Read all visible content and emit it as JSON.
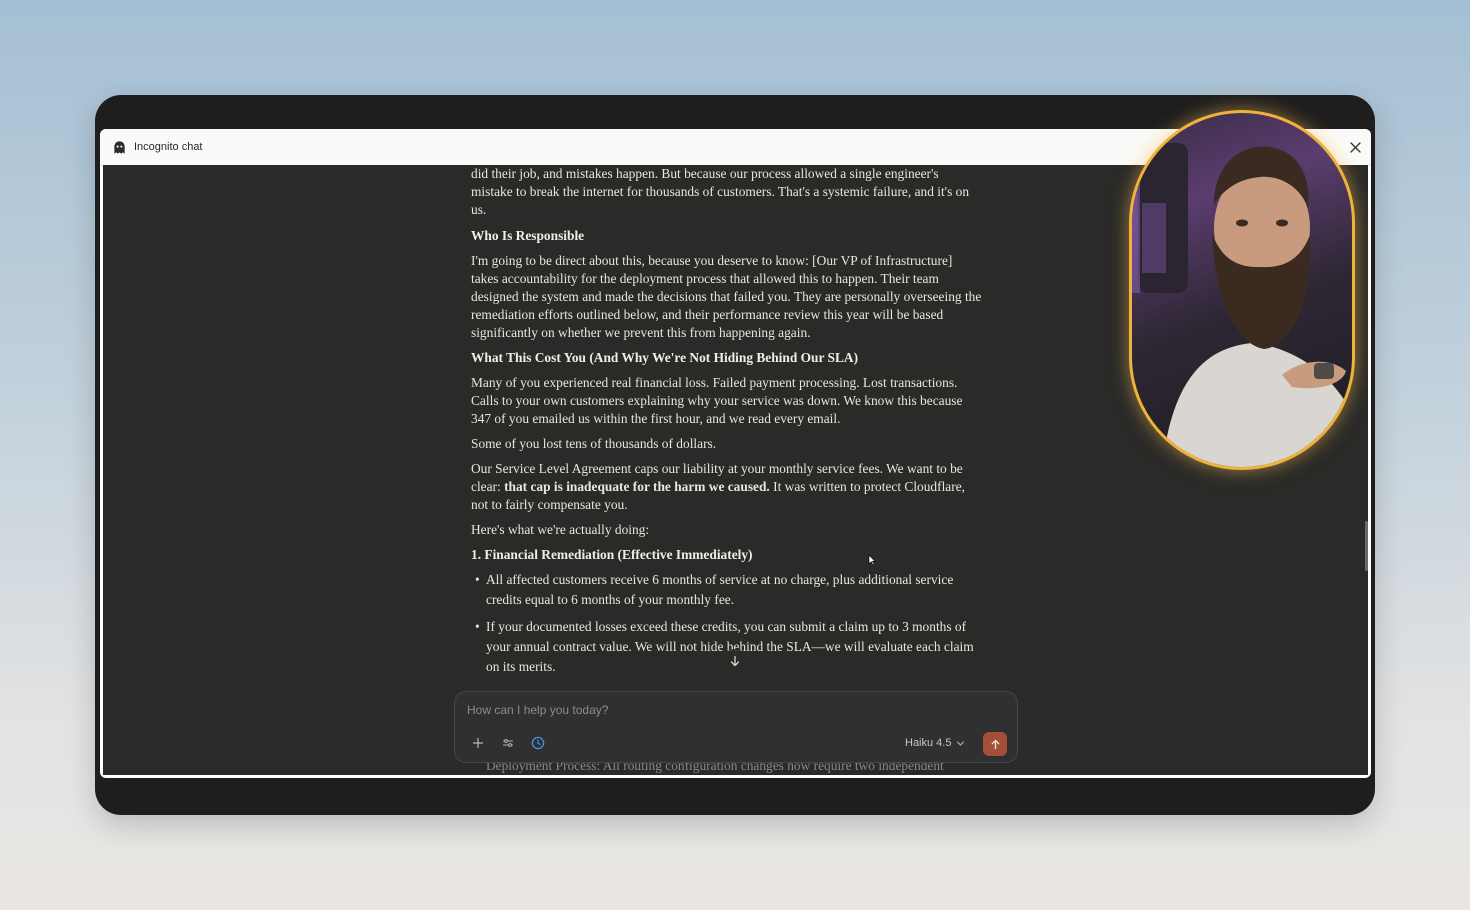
{
  "window": {
    "title": "Incognito chat"
  },
  "article": {
    "p1": "did their job, and mistakes happen. But because our process allowed a single engineer's mistake to break the internet for thousands of customers. That's a systemic failure, and it's on us.",
    "h1": "Who Is Responsible",
    "p2": "I'm going to be direct about this, because you deserve to know: [Our VP of Infrastructure] takes accountability for the deployment process that allowed this to happen. Their team designed the system and made the decisions that failed you. They are personally overseeing the remediation efforts outlined below, and their performance review this year will be based significantly on whether we prevent this from happening again.",
    "h2": "What This Cost You (And Why We're Not Hiding Behind Our SLA)",
    "p3": "Many of you experienced real financial loss. Failed payment processing. Lost transactions. Calls to your own customers explaining why your service was down. We know this because 347 of you emailed us within the first hour, and we read every email.",
    "p4": "Some of you lost tens of thousands of dollars.",
    "p5a": "Our Service Level Agreement caps our liability at your monthly service fees. We want to be clear: ",
    "p5b": "that cap is inadequate for the harm we caused.",
    "p5c": " It was written to protect Cloudflare, not to fairly compensate you.",
    "p6": "Here's what we're actually doing:",
    "h3": "1. Financial Remediation (Effective Immediately)",
    "bullets": [
      "All affected customers receive 6 months of service at no charge, plus additional service credits equal to 6 months of your monthly fee.",
      "If your documented losses exceed these credits, you can submit a claim up to 3 months of your annual contract value. We will not hide behind the SLA—we will evaluate each claim on its merits."
    ],
    "bleed": "Deployment Process: All routing configuration changes now require two independent"
  },
  "composer": {
    "placeholder": "How can I help you today?",
    "model": "Haiku 4.5"
  },
  "colors": {
    "accent_send": "#a44f3a",
    "webcam_ring": "#efb23a",
    "content_bg": "#2a2a28"
  },
  "icons": [
    "ghost-icon",
    "close-icon",
    "arrow-down-icon",
    "plus-icon",
    "sliders-icon",
    "clock-icon",
    "chevron-down-icon",
    "arrow-up-icon",
    "cursor-icon"
  ]
}
